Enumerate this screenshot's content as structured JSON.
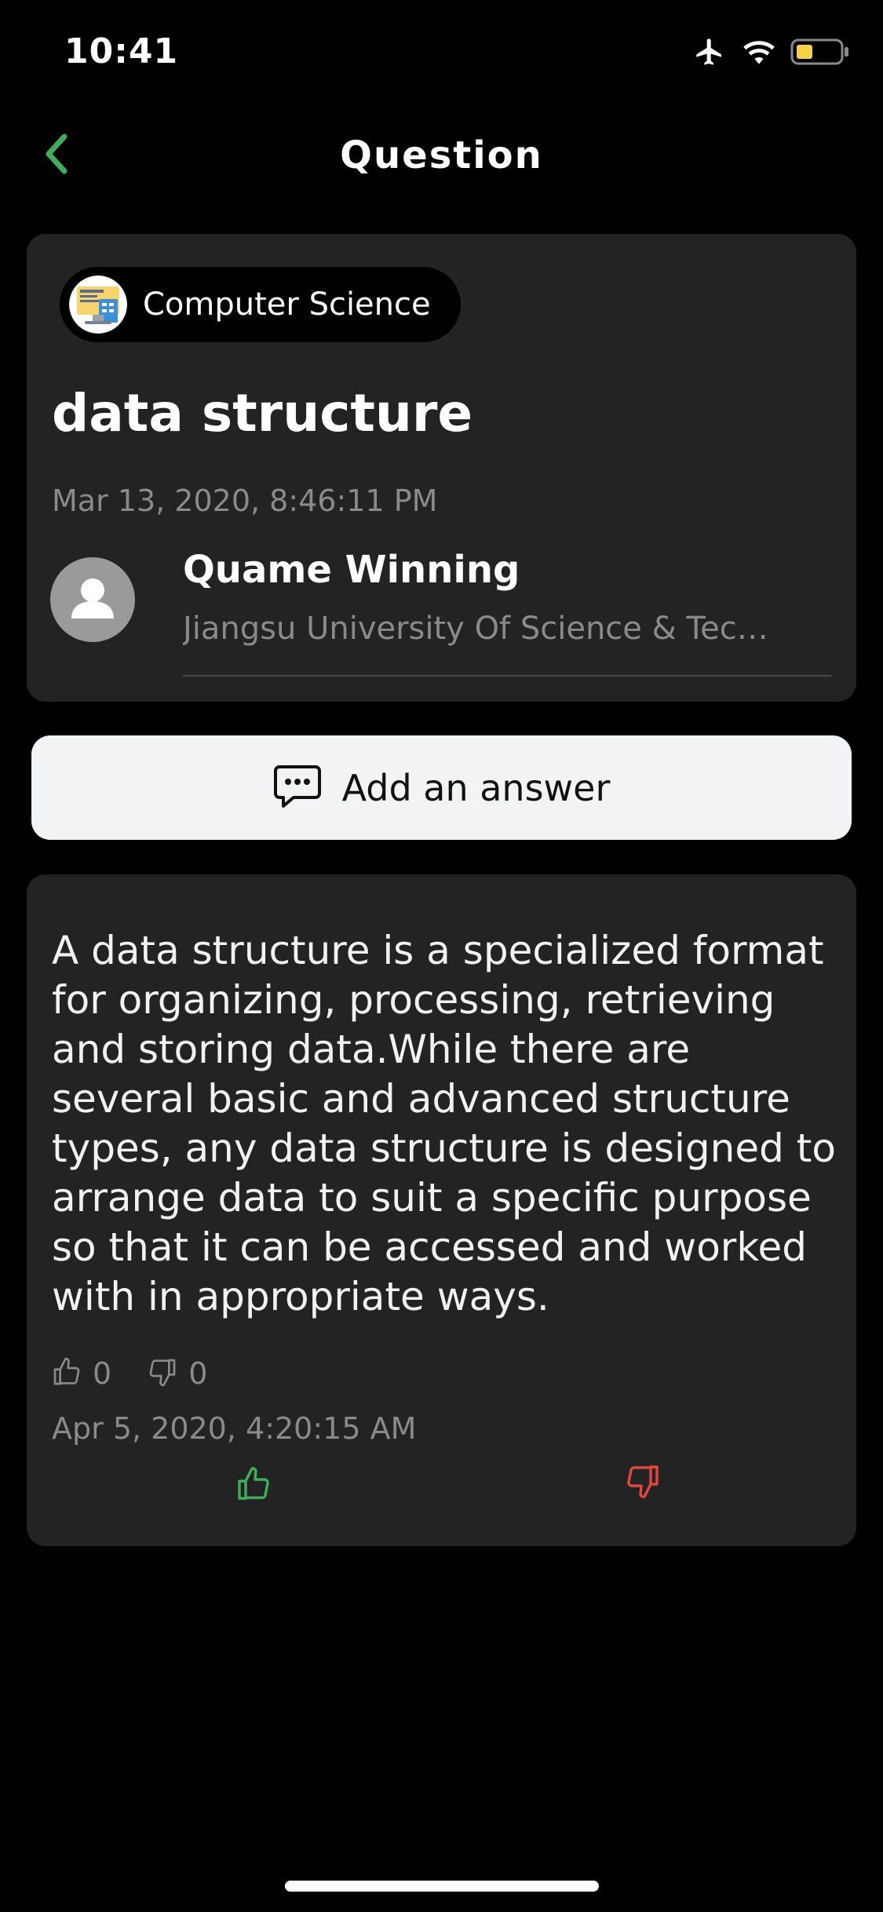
{
  "status_bar": {
    "time": "10:41",
    "icons": [
      "airplane-icon",
      "wifi-icon",
      "battery-icon"
    ],
    "battery_color": "#f5d14a"
  },
  "nav": {
    "title": "Question",
    "back_icon": "chevron-left-icon",
    "accent_color": "#3fae5c"
  },
  "question": {
    "category": "Computer Science",
    "category_icon": "computer-science-icon",
    "title": "data structure",
    "date": "Mar 13, 2020, 8:46:11 PM",
    "author": {
      "name": "Quame Winning",
      "school": "Jiangsu University Of Science & Technology",
      "avatar_icon": "user-avatar-icon"
    }
  },
  "add_answer": {
    "label": "Add an answer",
    "icon": "comment-dots-icon"
  },
  "answer": {
    "text": "A data structure is a specialized format for organizing, processing, retrieving and storing data.While there are several basic and advanced structure types, any data structure is designed to arrange data to suit a specific purpose so that it can be accessed and worked with in appropriate ways.",
    "likes": "0",
    "dislikes": "0",
    "date": "Apr 5, 2020, 4:20:15 AM",
    "upvote_color": "#3fae5c",
    "downvote_color": "#e0483e"
  }
}
